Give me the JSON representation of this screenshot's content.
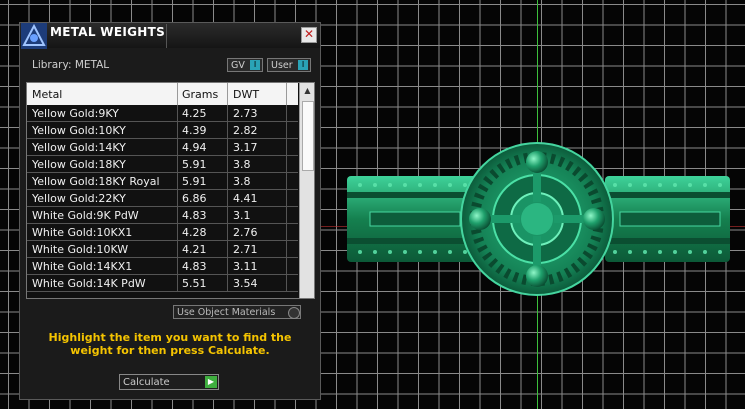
{
  "panel": {
    "title": "METAL WEIGHTS",
    "close_label": "✕",
    "library_label": "Library: METAL",
    "toggle_gv_label": "GV",
    "toggle_user_label": "User",
    "toggle_knob": "I"
  },
  "table": {
    "headers": [
      "Metal",
      "Grams",
      "DWT"
    ],
    "rows": [
      {
        "metal": "Yellow Gold:9KY",
        "grams": "4.25",
        "dwt": "2.73"
      },
      {
        "metal": "Yellow Gold:10KY",
        "grams": "4.39",
        "dwt": "2.82"
      },
      {
        "metal": "Yellow Gold:14KY",
        "grams": "4.94",
        "dwt": "3.17"
      },
      {
        "metal": "Yellow Gold:18KY",
        "grams": "5.91",
        "dwt": "3.8"
      },
      {
        "metal": "Yellow Gold:18KY Royal",
        "grams": "5.91",
        "dwt": "3.8"
      },
      {
        "metal": "Yellow Gold:22KY",
        "grams": "6.86",
        "dwt": "4.41"
      },
      {
        "metal": "White Gold:9K PdW",
        "grams": "4.83",
        "dwt": "3.1"
      },
      {
        "metal": "White Gold:10KX1",
        "grams": "4.28",
        "dwt": "2.76"
      },
      {
        "metal": "White Gold:10KW",
        "grams": "4.21",
        "dwt": "2.71"
      },
      {
        "metal": "White Gold:14KX1",
        "grams": "4.83",
        "dwt": "3.11"
      },
      {
        "metal": "White Gold:14K PdW",
        "grams": "5.51",
        "dwt": "3.54"
      }
    ]
  },
  "use_object_materials_label": "Use Object Materials",
  "instructions": "Highlight the item you want to find the weight for then press Calculate.",
  "calculate_label": "Calculate",
  "colors": {
    "ring_green": "#1f9a6a",
    "instruction_text": "#f5c400",
    "y_axis": "#3cbf3c"
  }
}
